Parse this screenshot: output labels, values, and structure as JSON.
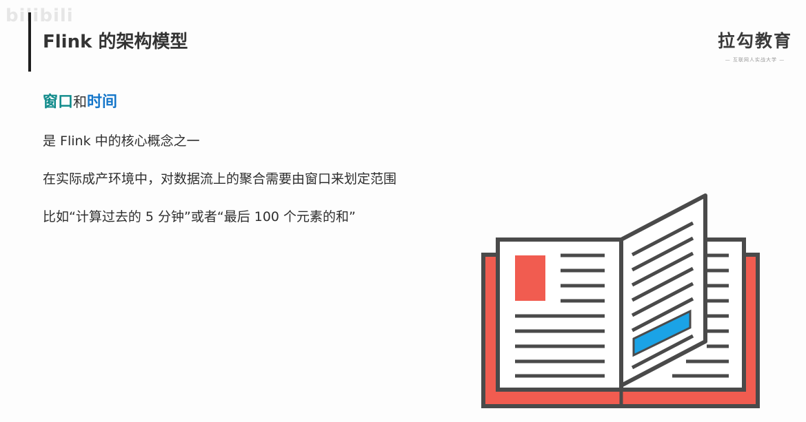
{
  "watermark": "bilibili",
  "page_title": "Flink 的架构模型",
  "brand": {
    "name": "拉勾教育",
    "tagline": "— 互联网人实战大学 —"
  },
  "section": {
    "heading_part1": "窗口",
    "heading_part2": "和",
    "heading_part3": "时间"
  },
  "body": {
    "line1": "是 Flink 中的核心概念之一",
    "line2": "在实际成产环境中，对数据流上的聚合需要由窗口来划定范围",
    "line3": "比如“计算过去的 5 分钟”或者“最后 100 个元素的和”"
  },
  "illustration": {
    "icon": "open-book-icon",
    "colors": {
      "cover": "#f15c50",
      "outline": "#4a4a4a",
      "highlight_red": "#f15c50",
      "highlight_blue": "#1ba3e6"
    }
  }
}
